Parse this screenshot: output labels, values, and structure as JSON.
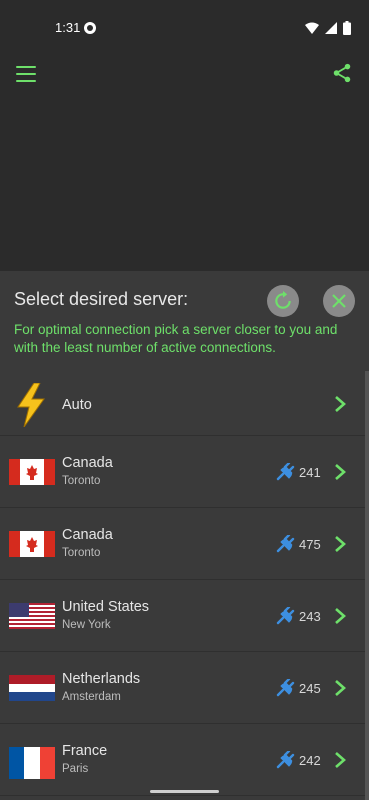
{
  "status": {
    "time": "1:31"
  },
  "sheet": {
    "title": "Select desired server:",
    "hint": "For optimal connection pick a server closer to you and with the least number of active connections."
  },
  "servers": [
    {
      "country": "Auto",
      "city": "",
      "connections": "",
      "flag": "lightning-icon"
    },
    {
      "country": "Canada",
      "city": "Toronto",
      "connections": "241",
      "flag": "canada-flag-icon"
    },
    {
      "country": "Canada",
      "city": "Toronto",
      "connections": "475",
      "flag": "canada-flag-icon"
    },
    {
      "country": "United States",
      "city": "New York",
      "connections": "243",
      "flag": "usa-flag-icon"
    },
    {
      "country": "Netherlands",
      "city": "Amsterdam",
      "connections": "245",
      "flag": "netherlands-flag-icon"
    },
    {
      "country": "France",
      "city": "Paris",
      "connections": "242",
      "flag": "france-flag-icon"
    }
  ],
  "colors": {
    "accent": "#6ee06a",
    "plug": "#3d8fe0",
    "sheet": "#3a3a3a",
    "background": "#2b2b2b"
  }
}
